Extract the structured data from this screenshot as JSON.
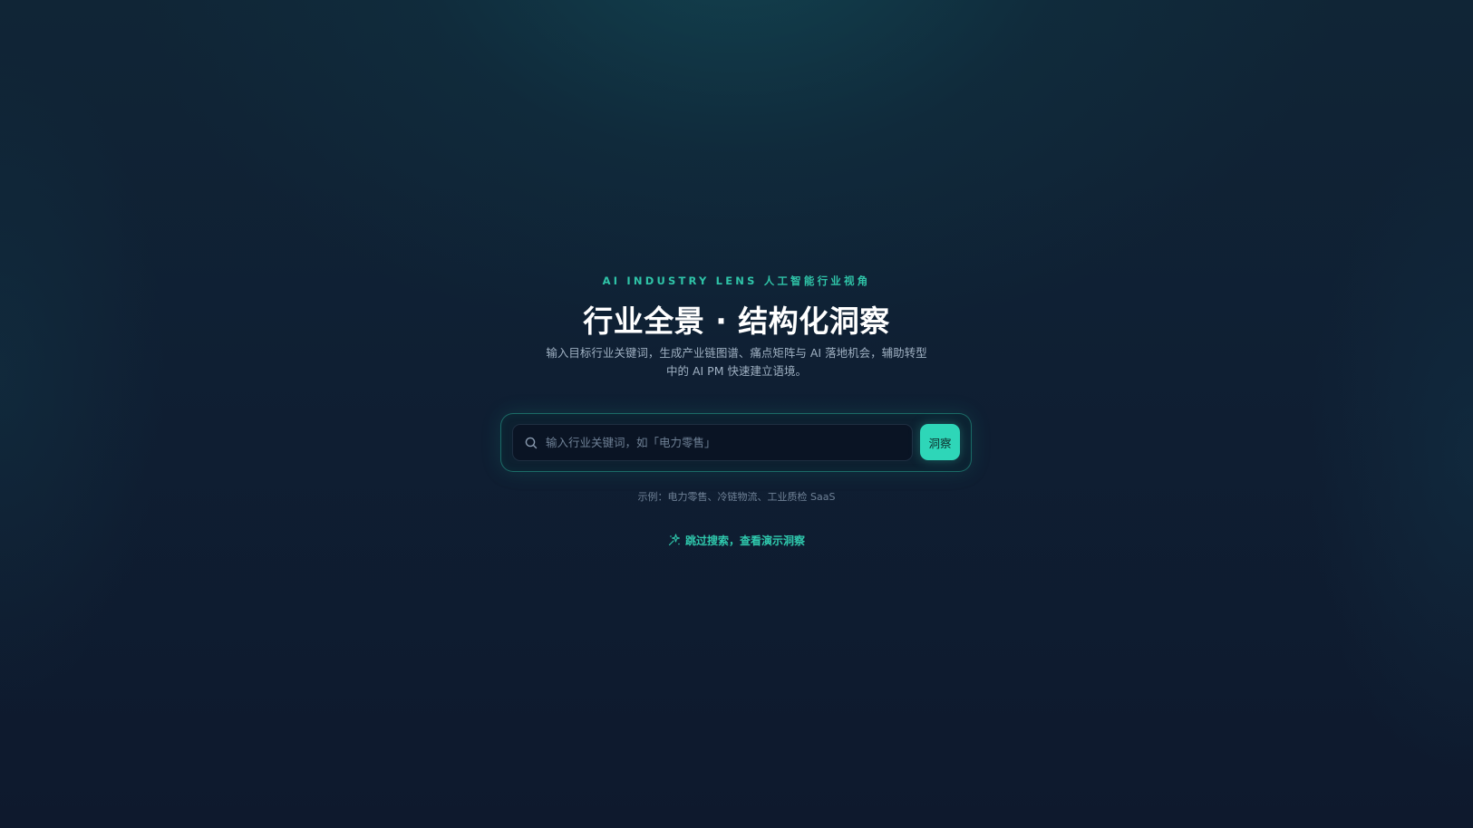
{
  "hero": {
    "eyebrow": "AI INDUSTRY LENS  人工智能行业视角",
    "title": "行业全景 · 结构化洞察",
    "subtitle": "输入目标行业关键词，生成产业链图谱、痛点矩阵与 AI 落地机会，辅助转型中的 AI PM 快速建立语境。"
  },
  "search": {
    "placeholder": "输入行业关键词，如「电力零售」",
    "value": "",
    "button_label": "洞察",
    "icon": "search-icon"
  },
  "examples": {
    "text": "示例：电力零售、冷链物流、工业质检 SaaS"
  },
  "demo": {
    "label": "跳过搜索，查看演示洞察",
    "icon": "sparkle-icon"
  },
  "colors": {
    "accent": "#2ed6b8",
    "background": "#0f1f33",
    "title": "#ffffff",
    "muted": "#9fb0c2"
  }
}
